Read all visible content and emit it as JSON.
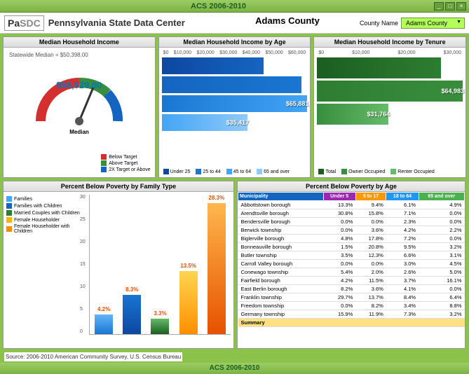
{
  "window": {
    "title": "ACS 2006-2010"
  },
  "header": {
    "logo_pa": "Pa",
    "logo_sdc": "SDC",
    "title": "Pennsylvania State Data Center",
    "county_title": "Adams County",
    "county_label": "County Name",
    "county_value": "Adams County"
  },
  "panels": {
    "gauge": {
      "title": "Median Household Income",
      "statewide": "Statewide Median = $50,398.00",
      "value": "$56,529.00",
      "median_label": "Median",
      "legend": [
        {
          "color": "#d32f2f",
          "label": "Below Target"
        },
        {
          "color": "#388e3c",
          "label": "Above Target"
        },
        {
          "color": "#1565c0",
          "label": "2X Target or Above"
        }
      ]
    },
    "age": {
      "title": "Median Household Income by Age",
      "axis": [
        "$0",
        "$10,000",
        "$20,000",
        "$30,000",
        "$40,000",
        "$50,000",
        "$60,000"
      ],
      "legend": [
        {
          "color": "#0d47a1",
          "label": "Under 25"
        },
        {
          "color": "#1976d2",
          "label": "25 to 44"
        },
        {
          "color": "#42a5f5",
          "label": "45 to 64"
        },
        {
          "color": "#90caf9",
          "label": "65 and over"
        }
      ]
    },
    "tenure": {
      "title": "Median Household Income by Tenure",
      "axis": [
        "$0",
        "$10,000",
        "$20,000",
        "$30,000"
      ],
      "legend": [
        {
          "color": "#1b5e20",
          "label": "Total"
        },
        {
          "color": "#388e3c",
          "label": "Owner Occupied"
        },
        {
          "color": "#66bb6a",
          "label": "Renter Occupied"
        }
      ]
    },
    "poverty_family": {
      "title": "Percent Below Poverty by Family Type"
    },
    "poverty_age": {
      "title": "Percent Below Poverty by Age"
    }
  },
  "chart_data": [
    {
      "id": "gauge",
      "type": "gauge",
      "value": 56529,
      "statewide_median": 50398,
      "min": 0,
      "max": 100000
    },
    {
      "id": "income_by_age",
      "type": "bar",
      "orientation": "horizontal",
      "categories": [
        "Under 25",
        "25 to 44",
        "45 to 64",
        "65 and over"
      ],
      "values": [
        42000,
        58000,
        65881,
        35417
      ],
      "value_labels": [
        "",
        "",
        "$65,881",
        "$35,417"
      ],
      "xlim": [
        0,
        60000
      ],
      "colors": [
        "#0d47a1",
        "#1976d2",
        "#42a5f5",
        "#90caf9"
      ]
    },
    {
      "id": "income_by_tenure",
      "type": "bar",
      "orientation": "horizontal",
      "categories": [
        "Total",
        "Owner Occupied",
        "Renter Occupied"
      ],
      "values": [
        56529,
        64983,
        31764
      ],
      "value_labels": [
        "",
        "$64,983",
        "$31,764"
      ],
      "xlim": [
        0,
        70000
      ],
      "colors": [
        "#1b5e20",
        "#388e3c",
        "#66bb6a"
      ]
    },
    {
      "id": "poverty_by_family",
      "type": "bar",
      "categories": [
        "Families",
        "Families with Children",
        "Married Couples with Children",
        "Female Householder",
        "Female Householder with Children"
      ],
      "values": [
        4.2,
        8.3,
        3.3,
        13.5,
        28.3
      ],
      "value_labels": [
        "4.2%",
        "8.3%",
        "3.3%",
        "13.5%",
        "28.3%"
      ],
      "colors": [
        "#42a5f5",
        "#1565c0",
        "#2e7d32",
        "#ffb300",
        "#fb8c00"
      ],
      "ylim": [
        0,
        30
      ]
    },
    {
      "id": "poverty_by_age",
      "type": "table",
      "columns": [
        "Municipality",
        "Under 5",
        "5 to 17",
        "18 to 64",
        "65 and over"
      ],
      "rows": [
        [
          "Abbottstown borough",
          "13.3%",
          "9.4%",
          "6.1%",
          "4.9%"
        ],
        [
          "Arendtsville borough",
          "30.8%",
          "15.8%",
          "7.1%",
          "0.0%"
        ],
        [
          "Bendersville borough",
          "0.0%",
          "0.0%",
          "2.3%",
          "0.0%"
        ],
        [
          "Berwick township",
          "0.0%",
          "3.6%",
          "4.2%",
          "2.2%"
        ],
        [
          "Biglerville borough",
          "4.8%",
          "17.8%",
          "7.2%",
          "0.0%"
        ],
        [
          "Bonneauville borough",
          "1.5%",
          "20.8%",
          "9.5%",
          "3.2%"
        ],
        [
          "Butler township",
          "3.5%",
          "12.3%",
          "6.6%",
          "3.1%"
        ],
        [
          "Carroll Valley borough",
          "0.0%",
          "0.0%",
          "3.0%",
          "4.5%"
        ],
        [
          "Conewago township",
          "5.4%",
          "2.0%",
          "2.6%",
          "5.0%"
        ],
        [
          "Fairfield borough",
          "4.2%",
          "11.5%",
          "3.7%",
          "16.1%"
        ],
        [
          "East Berlin borough",
          "8.2%",
          "3.6%",
          "4.1%",
          "0.0%"
        ],
        [
          "Franklin township",
          "29.7%",
          "13.7%",
          "8.4%",
          "6.4%"
        ],
        [
          "Freedom township",
          "0.0%",
          "8.2%",
          "3.4%",
          "8.8%"
        ],
        [
          "Germany township",
          "15.9%",
          "11.9%",
          "7.3%",
          "3.2%"
        ]
      ],
      "summary": [
        "Summary",
        "",
        "",
        "",
        ""
      ]
    }
  ],
  "poverty_legend": [
    {
      "color": "#42a5f5",
      "label": "Families"
    },
    {
      "color": "#1565c0",
      "label": "Families with Children"
    },
    {
      "color": "#2e7d32",
      "label": "Married Couples with Children"
    },
    {
      "color": "#ffb300",
      "label": "Female Householder"
    },
    {
      "color": "#fb8c00",
      "label": "Female Householder with Children"
    }
  ],
  "footer": {
    "source": "Source: 2006-2010 American Community Survey, U.S. Census Bureau",
    "bottom": "ACS 2006-2010"
  }
}
